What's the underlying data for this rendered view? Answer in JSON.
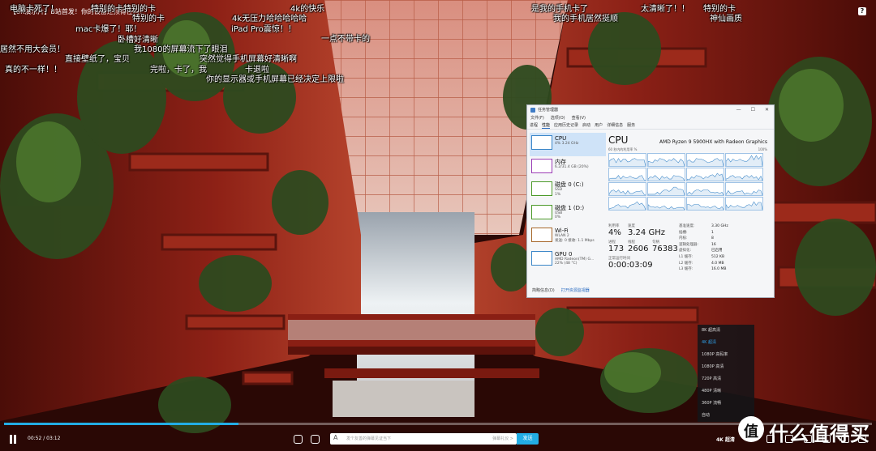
{
  "video": {
    "title": "【8K演示片】B站首发！你的设备还顶得住吗?",
    "help_icon": "?"
  },
  "danmaku": [
    "电脑卡死了！",
    "特别的卡特别的卡",
    "4k的快乐",
    "是我的手机卡了",
    "太清晰了！！",
    "特别的卡",
    "特别的卡",
    "4k无压力哈哈哈哈哈",
    "我的手机居然挺顺",
    "神仙画质",
    "iPad Pro震惊！！",
    "一点不带卡的",
    "mac卡爆了！耶！",
    "卧槽好清晰",
    "居然不用大会员！",
    "我1080的屏幕流下了眼泪",
    "直接壁纸了，宝贝",
    "突然觉得手机屏幕好清晰啊",
    "真的不一样！！",
    "完啦，卡了，我",
    "卡退啦",
    "你的显示器或手机屏幕已经决定上限啦"
  ],
  "task_manager": {
    "title": "任务管理器",
    "menu": [
      "文件(F)",
      "选项(O)",
      "查看(V)"
    ],
    "tabs": [
      "进程",
      "性能",
      "应用历史记录",
      "启动",
      "用户",
      "详细信息",
      "服务"
    ],
    "sidebar": [
      {
        "name": "CPU",
        "line1": "4%  3.24 GHz",
        "line2": ""
      },
      {
        "name": "内存",
        "line1": "6.2/31.4 GB (20%)",
        "line2": ""
      },
      {
        "name": "磁盘 0 (C:)",
        "line1": "SSD",
        "line2": "1%"
      },
      {
        "name": "磁盘 1 (D:)",
        "line1": "USB",
        "line2": "0%"
      },
      {
        "name": "Wi-Fi",
        "line1": "WLAN 2",
        "line2": "发送: 0 接收: 1.1 Mbps"
      },
      {
        "name": "GPU 0",
        "line1": "AMD Radeon(TM) G...",
        "line2": "22% (48 °C)"
      }
    ],
    "cpu": {
      "title": "CPU",
      "model": "AMD Ryzen 9 5900HX with Radeon Graphics",
      "graph_label": "60 秒内的利用率 %",
      "graph_max": "100%",
      "utilization_label": "利用率",
      "utilization": "4%",
      "speed_label": "速度",
      "speed": "3.24 GHz",
      "processes_label": "进程",
      "processes": "173",
      "threads_label": "线程",
      "threads": "2606",
      "handles_label": "句柄",
      "handles": "76383",
      "uptime_label": "正常运行时间",
      "uptime": "0:00:03:09",
      "details": [
        {
          "k": "基准速度:",
          "v": "3.30 GHz"
        },
        {
          "k": "插槽:",
          "v": "1"
        },
        {
          "k": "内核:",
          "v": "8"
        },
        {
          "k": "逻辑处理器:",
          "v": "16"
        },
        {
          "k": "虚拟化:",
          "v": "已启用"
        },
        {
          "k": "L1 缓存:",
          "v": "512 KB"
        },
        {
          "k": "L2 缓存:",
          "v": "4.0 MB"
        },
        {
          "k": "L3 缓存:",
          "v": "16.0 MB"
        }
      ]
    },
    "footer": {
      "brief": "简略信息(D)",
      "open_monitor": "打开资源监视器"
    }
  },
  "quality_menu": {
    "items": [
      "8K 超高清",
      "4K 超清",
      "1080P 高码率",
      "1080P 高清",
      "720P 高清",
      "480P 清晰",
      "360P 流畅",
      "自动"
    ],
    "active_index": 1
  },
  "player": {
    "current_time": "00:52",
    "duration": "03:12",
    "time_display": "00:52 / 03:12",
    "progress_fraction": 0.27,
    "danmaku_placeholder": "发个友善的弹幕见证当下",
    "etiquette": "弹幕礼仪 >",
    "send_label": "发送",
    "quality_label": "4K 超清",
    "accent": "#23ade5"
  },
  "watermark": {
    "logo_text": "值",
    "text": "什么值得买"
  }
}
